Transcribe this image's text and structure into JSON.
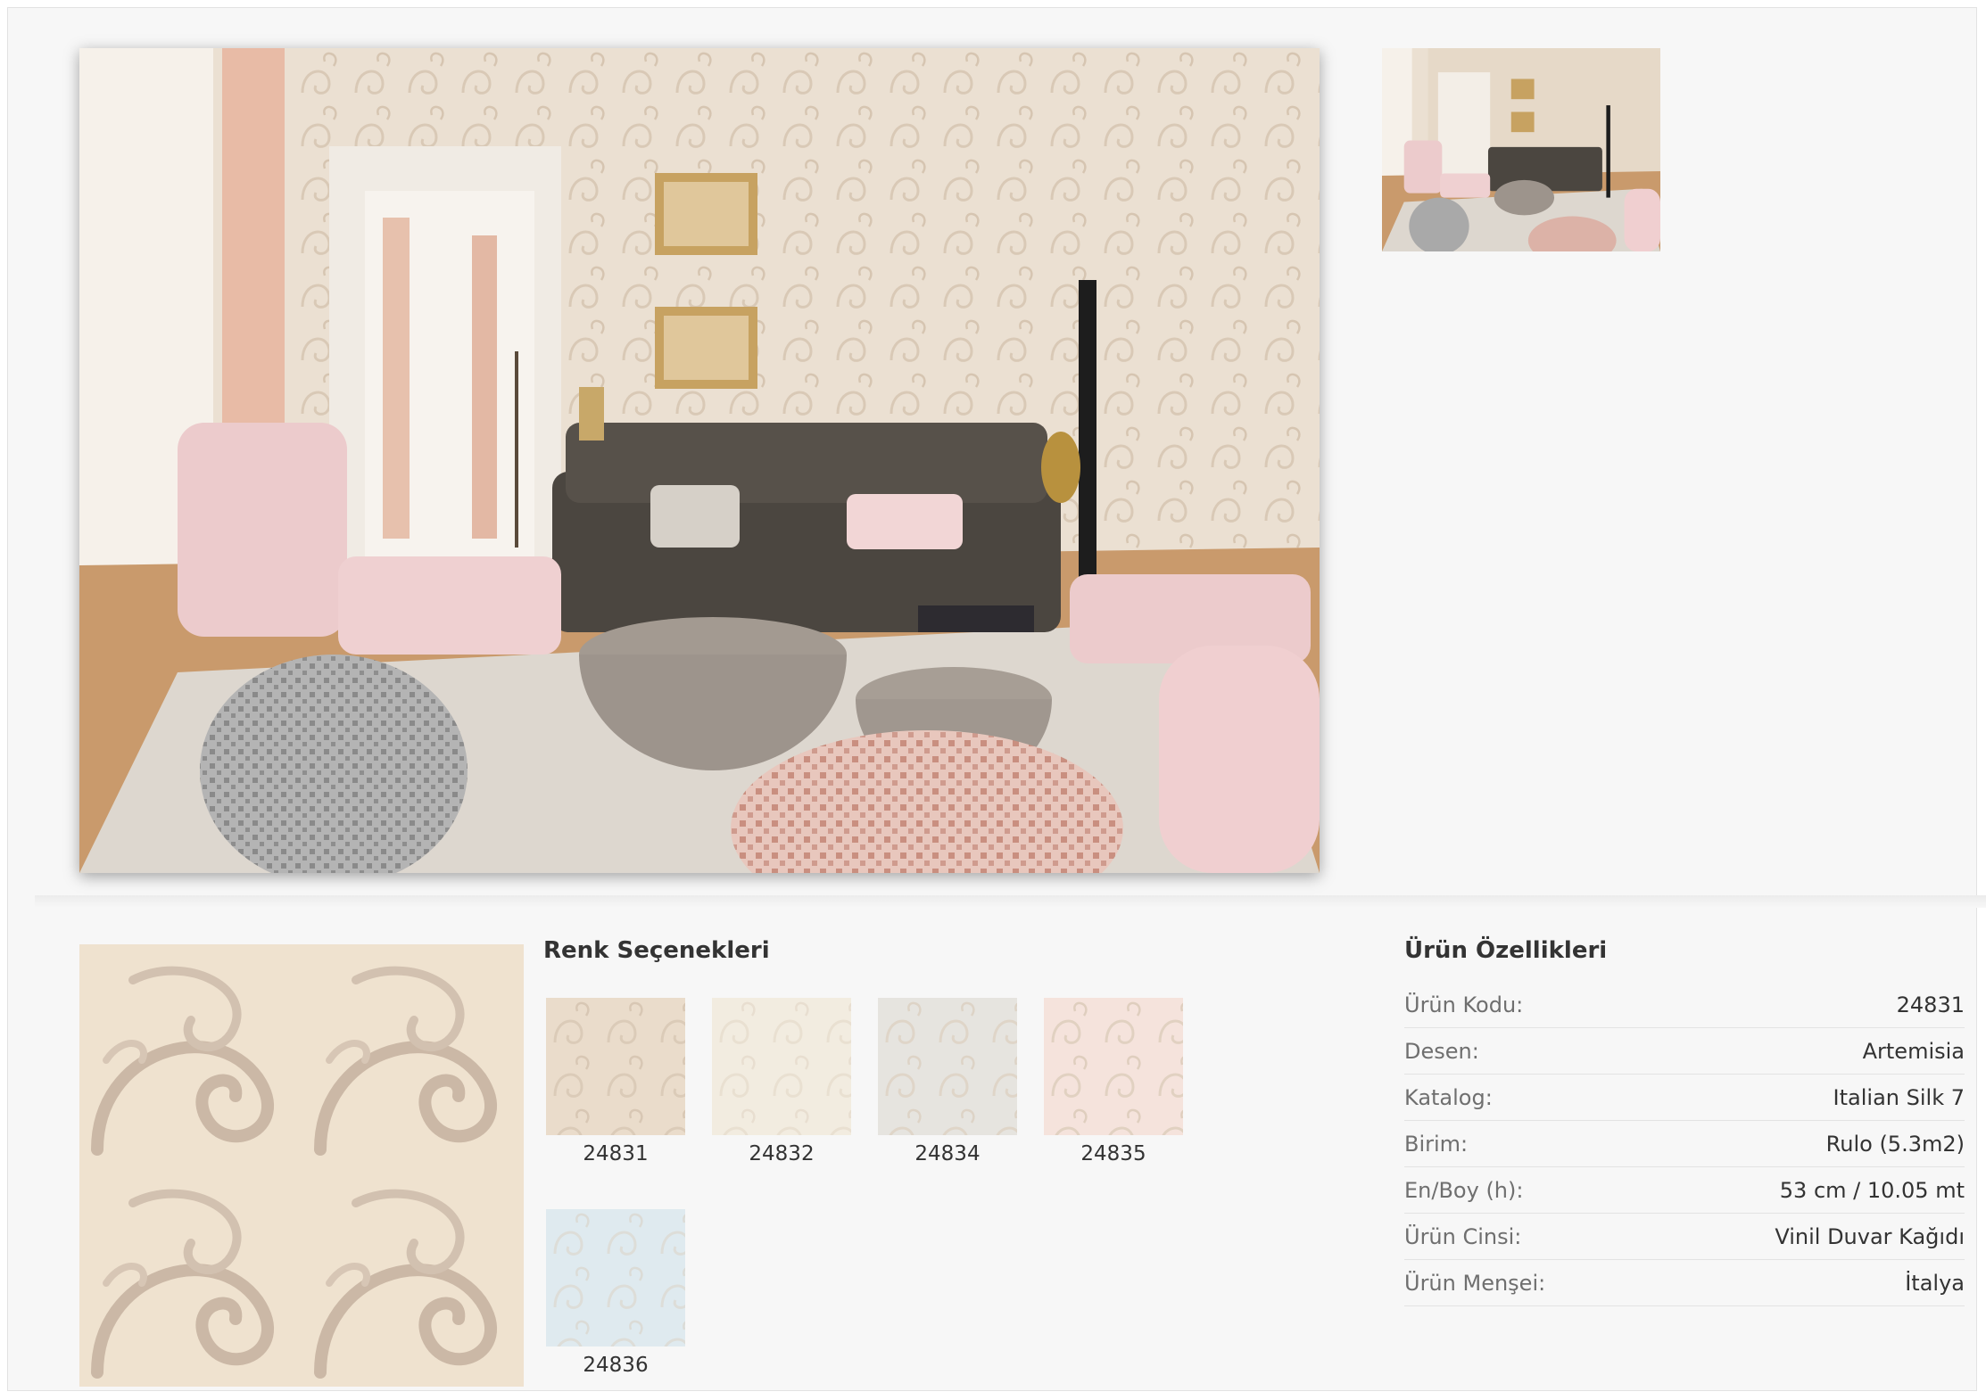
{
  "color_options": {
    "title": "Renk Seçenekleri",
    "items": [
      {
        "code": "24831",
        "color": "#eadccb"
      },
      {
        "code": "24832",
        "color": "#f2ece0"
      },
      {
        "code": "24834",
        "color": "#e6e4df"
      },
      {
        "code": "24835",
        "color": "#f5e3dc"
      },
      {
        "code": "24836",
        "color": "#dfeaef"
      }
    ]
  },
  "specs": {
    "title": "Ürün Özellikleri",
    "rows": [
      {
        "label": "Ürün Kodu:",
        "value": "24831"
      },
      {
        "label": "Desen:",
        "value": "Artemisia"
      },
      {
        "label": "Katalog:",
        "value": "Italian Silk 7"
      },
      {
        "label": "Birim:",
        "value": "Rulo (5.3m2)"
      },
      {
        "label": "En/Boy (h):",
        "value": "53 cm / 10.05 mt"
      },
      {
        "label": "Ürün Cinsi:",
        "value": "Vinil Duvar Kağıdı"
      },
      {
        "label": "Ürün Menşei:",
        "value": "İtalya"
      }
    ]
  },
  "colors": {
    "wallpaper": "#e8dccd",
    "sofa": "#4b4640",
    "pink_furniture": "#eccbcc",
    "table": "#9d948c",
    "floor": "#c99a6c"
  }
}
